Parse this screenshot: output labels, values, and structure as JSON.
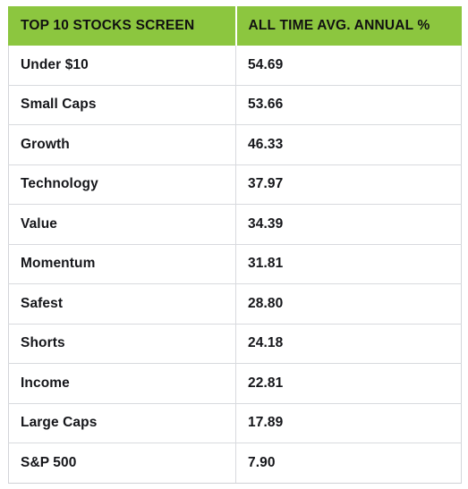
{
  "table": {
    "headers": [
      {
        "label": "TOP 10 STOCKS SCREEN"
      },
      {
        "label": "ALL TIME AVG. ANNUAL %"
      }
    ],
    "rows": [
      {
        "name": "Under $10",
        "value": "54.69"
      },
      {
        "name": "Small Caps",
        "value": "53.66"
      },
      {
        "name": "Growth",
        "value": "46.33"
      },
      {
        "name": "Technology",
        "value": "37.97"
      },
      {
        "name": "Value",
        "value": "34.39"
      },
      {
        "name": "Momentum",
        "value": "31.81"
      },
      {
        "name": "Safest",
        "value": "28.80"
      },
      {
        "name": "Shorts",
        "value": "24.18"
      },
      {
        "name": "Income",
        "value": "22.81"
      },
      {
        "name": "Large Caps",
        "value": "17.89"
      },
      {
        "name": "S&P 500",
        "value": "7.90"
      }
    ]
  },
  "colors": {
    "header_background": "#8CC63F",
    "header_text": "#111111",
    "body_text": "#15161a",
    "border": "#d8dade",
    "page_background": "#ffffff"
  },
  "chart_data": {
    "type": "table",
    "title": "",
    "columns": [
      "TOP 10 STOCKS SCREEN",
      "ALL TIME AVG. ANNUAL %"
    ],
    "categories": [
      "Under $10",
      "Small Caps",
      "Growth",
      "Technology",
      "Value",
      "Momentum",
      "Safest",
      "Shorts",
      "Income",
      "Large Caps",
      "S&P 500"
    ],
    "values": [
      54.69,
      53.66,
      46.33,
      37.97,
      34.39,
      31.81,
      28.8,
      24.18,
      22.81,
      17.89,
      7.9
    ],
    "xlabel": "",
    "ylabel": "All Time Avg. Annual %"
  }
}
